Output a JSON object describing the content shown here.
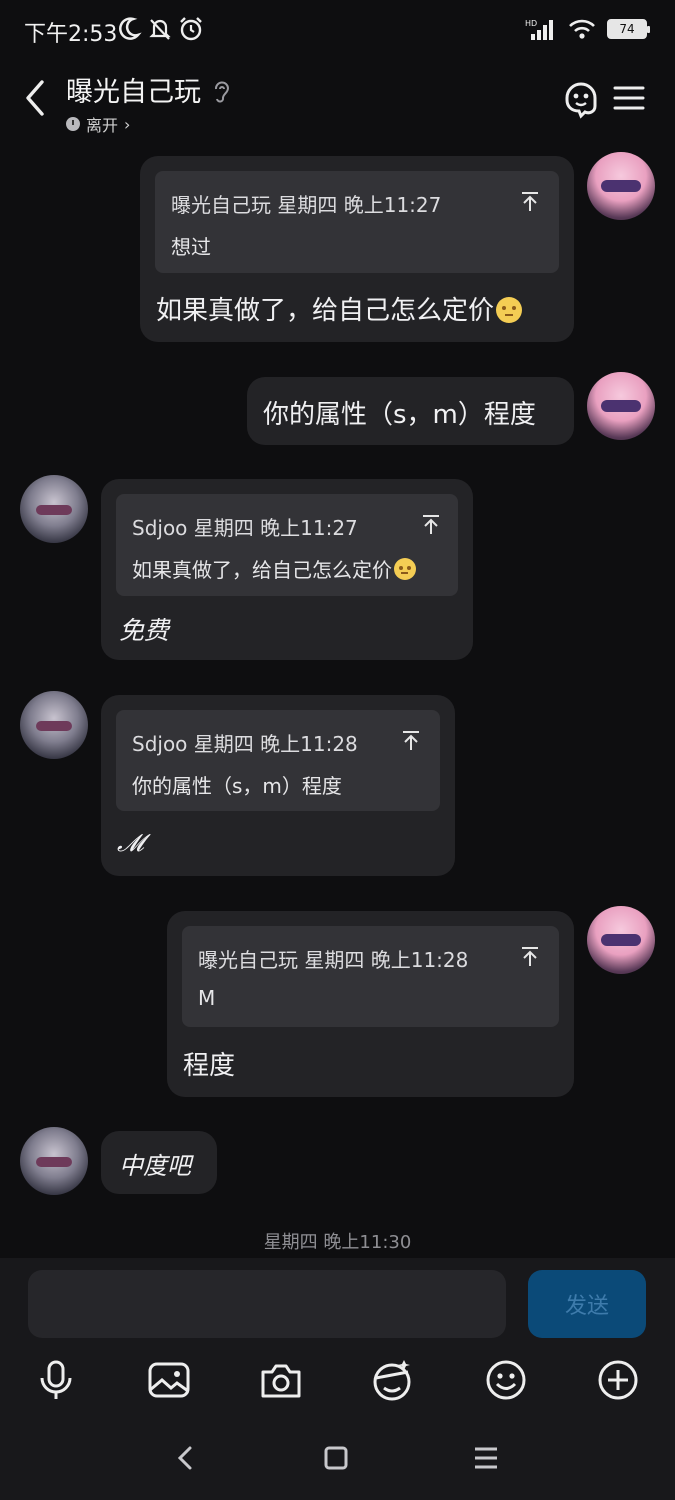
{
  "status_bar": {
    "time": "下午2:53",
    "battery": "74",
    "network": "HD"
  },
  "header": {
    "title": "曝光自己玩",
    "presence": "离开",
    "presence_chevron": "›"
  },
  "messages": [
    {
      "side": "right",
      "avatar": "pink-avatar",
      "quote": {
        "head": "曝光自己玩 星期四 晚上11:27",
        "body": "想过"
      },
      "text": "如果真做了，给自己怎么定价",
      "emoji": "flushed-face"
    },
    {
      "side": "right",
      "avatar": "pink-avatar",
      "text": "你的属性（s，m）程度"
    },
    {
      "side": "left",
      "avatar": "grey-avatar",
      "quote": {
        "head": "Sdjoo 星期四 晚上11:27",
        "body": "如果真做了，给自己怎么定价",
        "emoji": "flushed-face"
      },
      "text": "免费"
    },
    {
      "side": "left",
      "avatar": "grey-avatar",
      "quote": {
        "head": "Sdjoo 星期四 晚上11:28",
        "body": "你的属性（s，m）程度"
      },
      "text": "𝓜"
    },
    {
      "side": "right",
      "avatar": "pink-avatar",
      "quote": {
        "head": "曝光自己玩 星期四 晚上11:28",
        "body": "M"
      },
      "text": "程度"
    },
    {
      "side": "left",
      "avatar": "grey-avatar",
      "text": "中度吧"
    }
  ],
  "timestamp": "星期四 晚上11:30",
  "composer": {
    "placeholder": "",
    "value": "",
    "send_label": "发送"
  },
  "toolbar": [
    "mic-icon",
    "image-icon",
    "camera-icon",
    "sticker-icon",
    "emoji-icon",
    "plus-icon"
  ],
  "colors": {
    "background": "#0e0e10",
    "bubble": "#232326",
    "quote": "#333337",
    "send_button": "#0b4a78"
  }
}
